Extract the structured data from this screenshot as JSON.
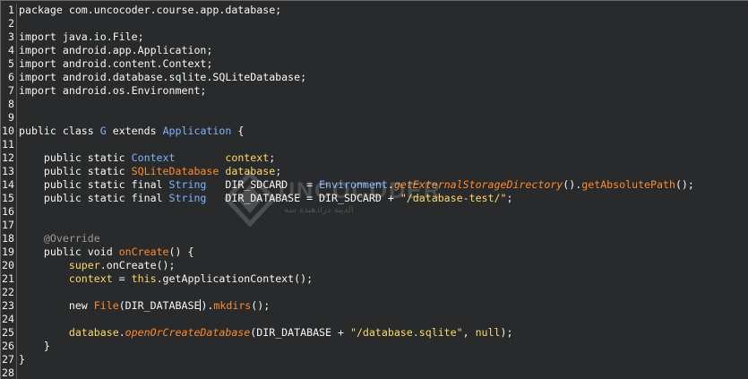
{
  "lines": [
    {
      "n": "1",
      "parts": [
        {
          "t": "package com.uncocoder.course.app.database;",
          "c": "kw"
        }
      ]
    },
    {
      "n": "2",
      "parts": []
    },
    {
      "n": "3",
      "parts": [
        {
          "t": "import java.io.File;",
          "c": "kw"
        }
      ]
    },
    {
      "n": "4",
      "parts": [
        {
          "t": "import android.app.Application;",
          "c": "kw"
        }
      ]
    },
    {
      "n": "5",
      "parts": [
        {
          "t": "import android.content.Context;",
          "c": "kw"
        }
      ]
    },
    {
      "n": "6",
      "parts": [
        {
          "t": "import android.database.sqlite.SQLiteDatabase;",
          "c": "kw"
        }
      ]
    },
    {
      "n": "7",
      "parts": [
        {
          "t": "import android.os.Environment;",
          "c": "kw"
        }
      ]
    },
    {
      "n": "8",
      "parts": []
    },
    {
      "n": "9",
      "parts": []
    },
    {
      "n": "10",
      "parts": [
        {
          "t": "public class ",
          "c": "kw"
        },
        {
          "t": "G",
          "c": "type"
        },
        {
          "t": " extends ",
          "c": "kw"
        },
        {
          "t": "Application",
          "c": "type"
        },
        {
          "t": " {",
          "c": "kw"
        }
      ]
    },
    {
      "n": "11",
      "parts": []
    },
    {
      "n": "12",
      "parts": [
        {
          "t": "    public static ",
          "c": "kw"
        },
        {
          "t": "Context",
          "c": "type"
        },
        {
          "t": "        ",
          "c": "kw"
        },
        {
          "t": "context",
          "c": "ident"
        },
        {
          "t": ";",
          "c": "kw"
        }
      ]
    },
    {
      "n": "13",
      "parts": [
        {
          "t": "    public static ",
          "c": "kw"
        },
        {
          "t": "SQLiteDatabase",
          "c": "method"
        },
        {
          "t": " ",
          "c": "kw"
        },
        {
          "t": "database",
          "c": "ident"
        },
        {
          "t": ";",
          "c": "kw"
        }
      ]
    },
    {
      "n": "14",
      "parts": [
        {
          "t": "    public static final ",
          "c": "kw"
        },
        {
          "t": "String",
          "c": "type"
        },
        {
          "t": "   DIR_SDCARD   = ",
          "c": "kw"
        },
        {
          "t": "Environment",
          "c": "type"
        },
        {
          "t": ".",
          "c": "kw"
        },
        {
          "t": "getExternalStorageDirectory",
          "c": "italic-method"
        },
        {
          "t": "().",
          "c": "kw"
        },
        {
          "t": "getAbsolutePath",
          "c": "method"
        },
        {
          "t": "();",
          "c": "kw"
        }
      ]
    },
    {
      "n": "15",
      "parts": [
        {
          "t": "    public static final ",
          "c": "kw"
        },
        {
          "t": "String",
          "c": "type"
        },
        {
          "t": "   DIR_DATABASE = DIR_SDCARD + ",
          "c": "kw"
        },
        {
          "t": "\"/database-test/\"",
          "c": "str"
        },
        {
          "t": ";",
          "c": "kw"
        }
      ]
    },
    {
      "n": "16",
      "parts": []
    },
    {
      "n": "17",
      "parts": []
    },
    {
      "n": "18",
      "parts": [
        {
          "t": "    @Override",
          "c": "annotation"
        }
      ]
    },
    {
      "n": "19",
      "parts": [
        {
          "t": "    public void ",
          "c": "kw"
        },
        {
          "t": "onCreate",
          "c": "method"
        },
        {
          "t": "() {",
          "c": "kw"
        }
      ]
    },
    {
      "n": "20",
      "parts": [
        {
          "t": "        super",
          "c": "ident"
        },
        {
          "t": ".onCreate();",
          "c": "kw"
        }
      ]
    },
    {
      "n": "21",
      "parts": [
        {
          "t": "        context",
          "c": "ident"
        },
        {
          "t": " = ",
          "c": "kw"
        },
        {
          "t": "this",
          "c": "ident"
        },
        {
          "t": ".getApplicationContext();",
          "c": "kw"
        }
      ]
    },
    {
      "n": "22",
      "parts": []
    },
    {
      "n": "23",
      "parts": [
        {
          "t": "        new ",
          "c": "kw"
        },
        {
          "t": "File",
          "c": "method"
        },
        {
          "t": "(DIR_DATABASE",
          "c": "kw"
        },
        {
          "t": "CURSOR",
          "c": "cursor"
        },
        {
          "t": ").",
          "c": "kw"
        },
        {
          "t": "mkdirs",
          "c": "method"
        },
        {
          "t": "();",
          "c": "kw"
        }
      ]
    },
    {
      "n": "24",
      "parts": []
    },
    {
      "n": "25",
      "parts": [
        {
          "t": "        database",
          "c": "ident"
        },
        {
          "t": ".",
          "c": "kw"
        },
        {
          "t": "openOrCreateDatabase",
          "c": "italic-method"
        },
        {
          "t": "(DIR_DATABASE + ",
          "c": "kw"
        },
        {
          "t": "\"/database.sqlite\"",
          "c": "str"
        },
        {
          "t": ", ",
          "c": "kw"
        },
        {
          "t": "null",
          "c": "ident"
        },
        {
          "t": ");",
          "c": "kw"
        }
      ]
    },
    {
      "n": "26",
      "parts": [
        {
          "t": "    }",
          "c": "kw"
        }
      ]
    },
    {
      "n": "27",
      "parts": [
        {
          "t": "}",
          "c": "kw"
        }
      ]
    },
    {
      "n": "28",
      "parts": []
    }
  ],
  "watermark": {
    "brand": "UNCOCODER",
    "subtitle": "الدینه درادهنده سه"
  },
  "colors": {
    "background": "#292a2b",
    "keyword": "#f7f7f7",
    "type": "#7fb4ff",
    "identifier": "#ffd866",
    "method": "#ff8a2b",
    "annotation": "#9a9a9a"
  }
}
